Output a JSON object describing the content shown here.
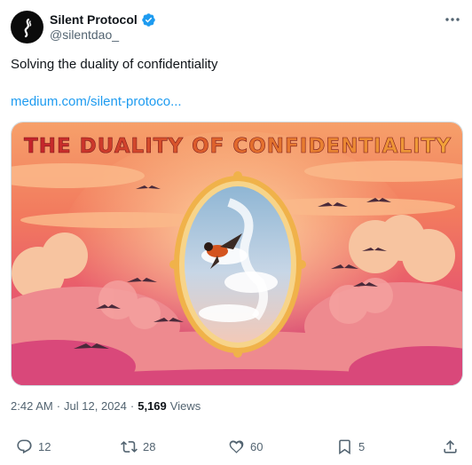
{
  "author": {
    "name": "Silent Protocol",
    "handle": "@silentdao_",
    "verified": true
  },
  "tweet": {
    "text": "Solving the duality of confidentiality",
    "link": "medium.com/silent-protoco..."
  },
  "media": {
    "title": "THE DUALITY OF CONFIDENTIALITY"
  },
  "meta": {
    "time": "2:42 AM",
    "dot": "·",
    "date": "Jul 12, 2024",
    "dot2": "·",
    "views_count": "5,169",
    "views_label": "Views"
  },
  "actions": {
    "replies": "12",
    "reposts": "28",
    "likes": "60",
    "bookmarks": "5"
  },
  "colors": {
    "accent": "#1d9bf0",
    "muted": "#536471"
  }
}
